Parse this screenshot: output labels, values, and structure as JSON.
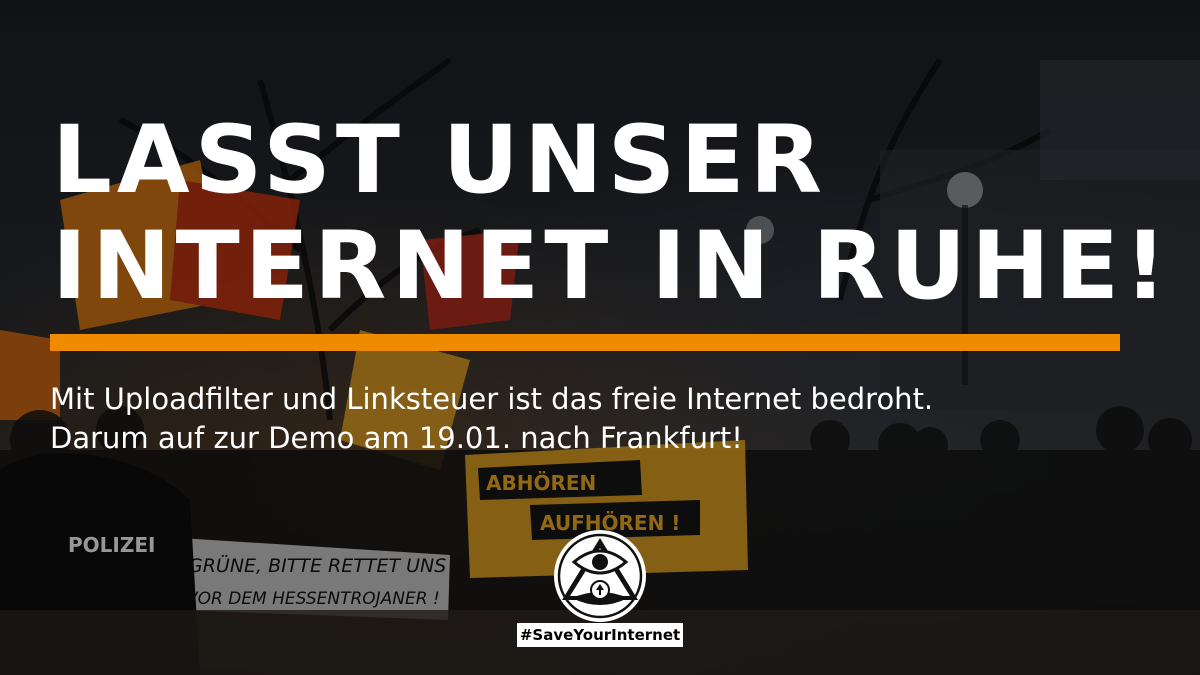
{
  "headline": {
    "line1": "LASST UNSER",
    "line2": "INTERNET IN RUHE!"
  },
  "subtext": {
    "line1": "Mit Uploadfilter und Linksteuer ist das freie Internet bedroht.",
    "line2": "Darum auf zur Demo am 19.01. nach Frankfurt!"
  },
  "hashtag": "#SaveYourInternet",
  "photo_signs": {
    "police": "POLIZEI",
    "banner_top": "ABHÖREN",
    "banner_bottom": "AUFHÖREN !",
    "bottom_banner_line1": "GRÜNE, BITTE RETTET UNS",
    "bottom_banner_line2": "VOR DEM HESSENTROJANER !"
  },
  "colors": {
    "accent": "#f08a00",
    "text": "#ffffff",
    "banner_yellow": "#e0a020",
    "flag_orange": "#e07a10"
  }
}
